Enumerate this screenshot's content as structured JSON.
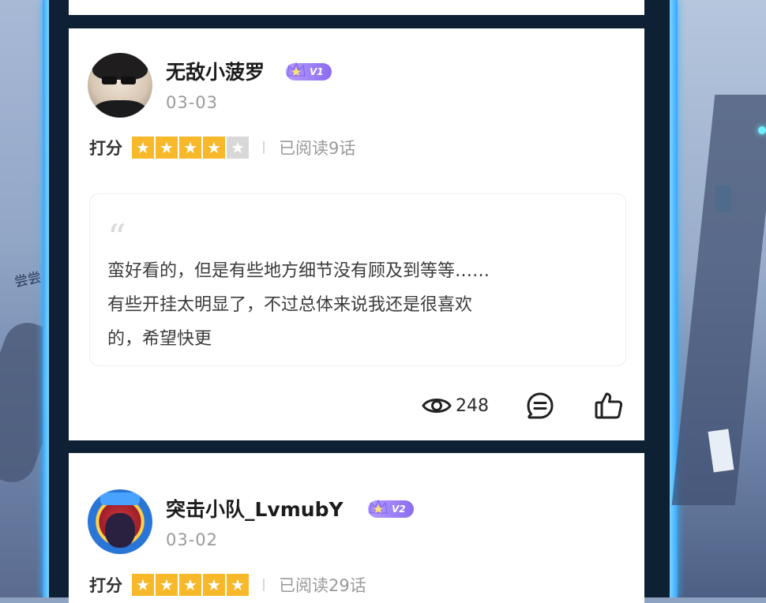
{
  "colors": {
    "column_bg": "#0d2034",
    "card_bg": "#ffffff",
    "star_on": "#f7b82a",
    "star_off": "#d8d8d8",
    "vip_badge": "#9b7ef5",
    "glow": "#39b4ff"
  },
  "side_art": {
    "left_text": "尝尝"
  },
  "comments": [
    {
      "username": "无敌小菠罗",
      "vip_level": "V1",
      "date": "03-03",
      "rating_label": "打分",
      "rating": 4,
      "rating_max": 5,
      "read_count": "已阅读9话",
      "quote_icon": "quote-mark-icon",
      "text": "蛮好看的，但是有些地方细节没有顾及到等等……\n有些开挂太明显了，不过总体来说我还是很喜欢\n的，希望快更",
      "views": "248",
      "view_icon": "eye-icon",
      "reply_icon": "comment-icon",
      "like_icon": "thumbs-up-icon"
    },
    {
      "username": "突击小队_LvmubY",
      "vip_level": "V2",
      "date": "03-02",
      "rating_label": "打分",
      "rating": 5,
      "rating_max": 5,
      "read_count": "已阅读29话"
    }
  ]
}
